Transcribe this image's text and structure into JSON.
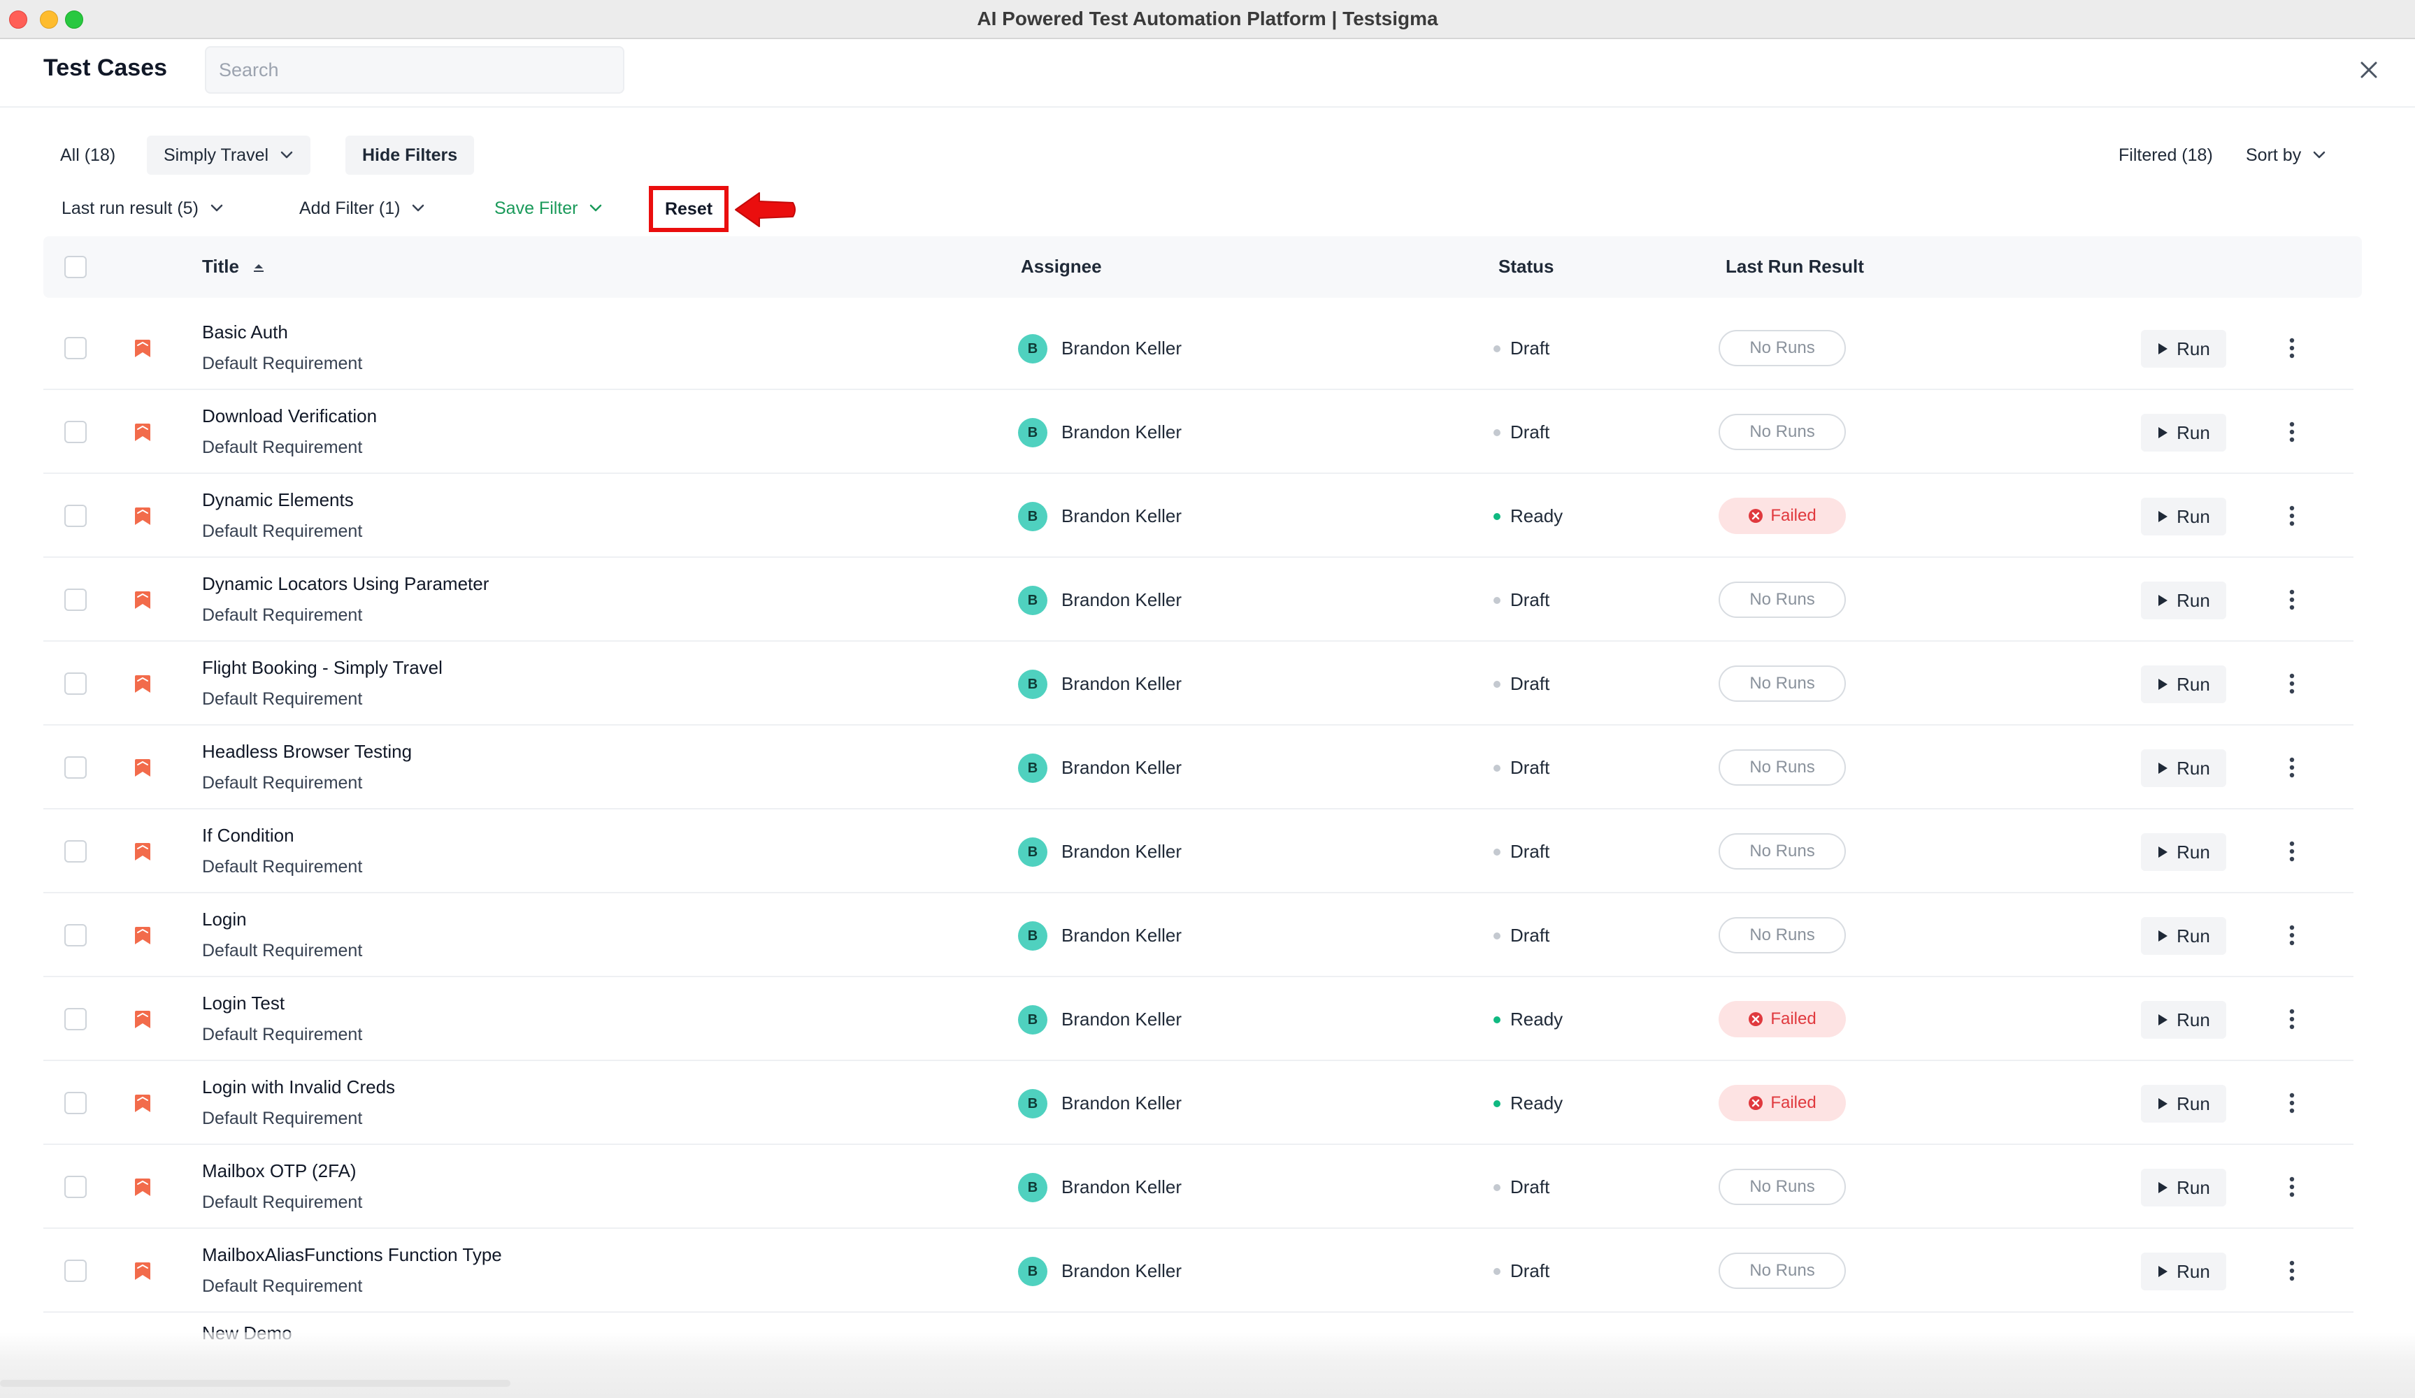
{
  "window": {
    "title": "AI Powered Test Automation Platform | Testsigma"
  },
  "header": {
    "title": "Test Cases",
    "search_placeholder": "Search"
  },
  "filters": {
    "all_label": "All (18)",
    "project_label": "Simply Travel",
    "hide_filters_label": "Hide Filters",
    "filtered_label": "Filtered (18)",
    "sort_label": "Sort by",
    "last_run_label": "Last run result (5)",
    "add_filter_label": "Add Filter (1)",
    "save_filter_label": "Save Filter",
    "reset_label": "Reset"
  },
  "table": {
    "headers": {
      "title": "Title",
      "assignee": "Assignee",
      "status": "Status",
      "last_run": "Last Run Result"
    },
    "run_label": "Run",
    "rows": [
      {
        "title": "Basic Auth",
        "requirement": "Default Requirement",
        "assignee_initial": "B",
        "assignee": "Brandon Keller",
        "status": "Draft",
        "result": "No Runs"
      },
      {
        "title": "Download Verification",
        "requirement": "Default Requirement",
        "assignee_initial": "B",
        "assignee": "Brandon Keller",
        "status": "Draft",
        "result": "No Runs"
      },
      {
        "title": "Dynamic Elements",
        "requirement": "Default Requirement",
        "assignee_initial": "B",
        "assignee": "Brandon Keller",
        "status": "Ready",
        "result": "Failed"
      },
      {
        "title": "Dynamic Locators Using Parameter",
        "requirement": "Default Requirement",
        "assignee_initial": "B",
        "assignee": "Brandon Keller",
        "status": "Draft",
        "result": "No Runs"
      },
      {
        "title": "Flight Booking - Simply Travel",
        "requirement": "Default Requirement",
        "assignee_initial": "B",
        "assignee": "Brandon Keller",
        "status": "Draft",
        "result": "No Runs"
      },
      {
        "title": "Headless Browser Testing",
        "requirement": "Default Requirement",
        "assignee_initial": "B",
        "assignee": "Brandon Keller",
        "status": "Draft",
        "result": "No Runs"
      },
      {
        "title": "If Condition",
        "requirement": "Default Requirement",
        "assignee_initial": "B",
        "assignee": "Brandon Keller",
        "status": "Draft",
        "result": "No Runs"
      },
      {
        "title": "Login",
        "requirement": "Default Requirement",
        "assignee_initial": "B",
        "assignee": "Brandon Keller",
        "status": "Draft",
        "result": "No Runs"
      },
      {
        "title": "Login Test",
        "requirement": "Default Requirement",
        "assignee_initial": "B",
        "assignee": "Brandon Keller",
        "status": "Ready",
        "result": "Failed"
      },
      {
        "title": "Login with Invalid Creds",
        "requirement": "Default Requirement",
        "assignee_initial": "B",
        "assignee": "Brandon Keller",
        "status": "Ready",
        "result": "Failed"
      },
      {
        "title": "Mailbox OTP (2FA)",
        "requirement": "Default Requirement",
        "assignee_initial": "B",
        "assignee": "Brandon Keller",
        "status": "Draft",
        "result": "No Runs"
      },
      {
        "title": "MailboxAliasFunctions Function Type",
        "requirement": "Default Requirement",
        "assignee_initial": "B",
        "assignee": "Brandon Keller",
        "status": "Draft",
        "result": "No Runs"
      }
    ],
    "partial_row_title": "New Demo"
  },
  "colors": {
    "accent_green": "#1a9a5a",
    "reset_highlight": "#ea0e0e",
    "ready": "#10b981",
    "failed": "#e0393e",
    "flag": "#f26b4b",
    "avatar": "#4fd1bf"
  },
  "icons": {
    "close": "close-icon",
    "chevron": "chevron-down-icon",
    "sort": "sort-ascending-icon",
    "flag": "priority-flag-icon",
    "play": "play-icon",
    "more": "more-vertical-icon",
    "failed": "x-circle-icon",
    "annotation": "red-arrow-icon"
  }
}
